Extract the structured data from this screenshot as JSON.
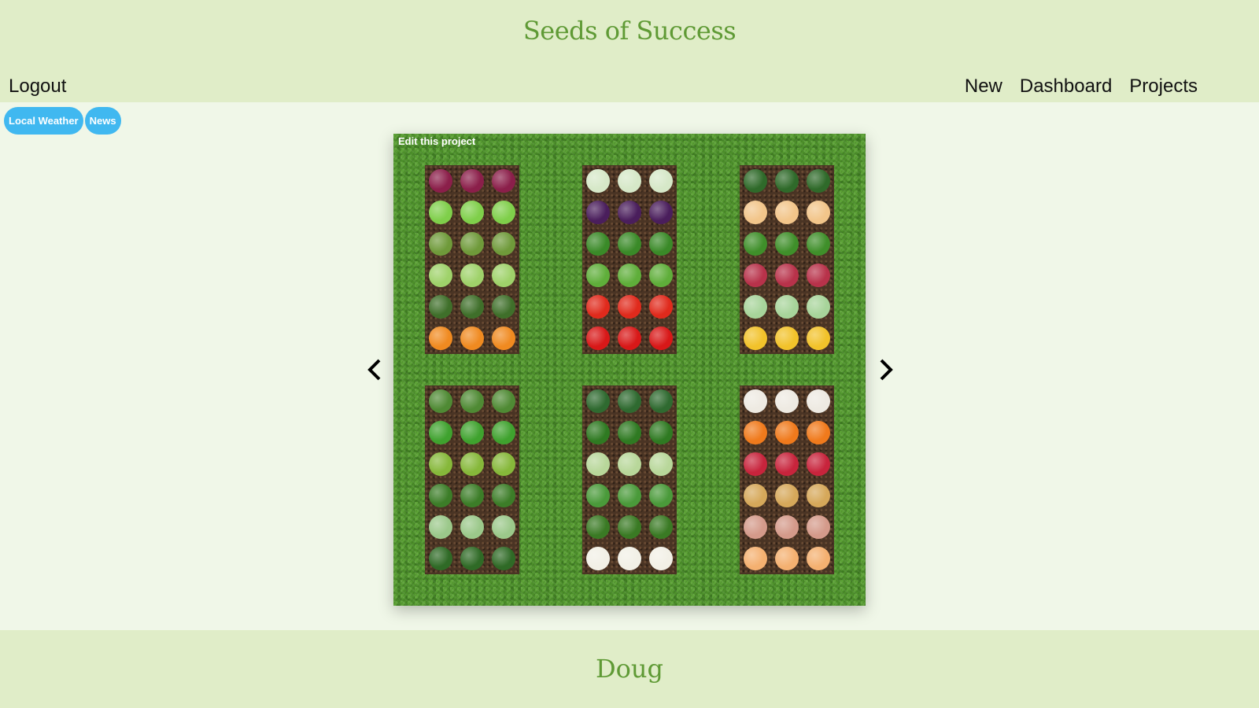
{
  "header": {
    "site_title": "Seeds of Success",
    "logout_label": "Logout",
    "nav": [
      "New",
      "Dashboard",
      "Projects"
    ]
  },
  "quick_links": [
    "Local Weather",
    "News"
  ],
  "garden": {
    "edit_label": "Edit this project",
    "beds": [
      [
        "beet",
        "bok-choy",
        "asparagus",
        "cabbage",
        "zucchini",
        "pumpkin"
      ],
      [
        "leek",
        "eggplant",
        "pea-pod",
        "green-bean",
        "tomato",
        "red-pepper"
      ],
      [
        "watermelon",
        "cantaloupe",
        "lettuce",
        "rhubarb",
        "chard",
        "corn"
      ],
      [
        "herb",
        "basil",
        "leaf-lettuce",
        "parsley",
        "dill",
        "rosemary"
      ],
      [
        "spinach",
        "cucumber",
        "savoy-cabbage",
        "kale",
        "broccoli",
        "cauliflower"
      ],
      [
        "garlic",
        "carrot",
        "radish",
        "potato",
        "sweet-potato",
        "onion"
      ]
    ],
    "colors": {
      "beet": "#8b1f4a",
      "bok-choy": "#7fcf4a",
      "asparagus": "#6f9a3a",
      "cabbage": "#9fd26a",
      "zucchini": "#3f6f2a",
      "pumpkin": "#f08a20",
      "leek": "#d6e8c8",
      "eggplant": "#4a1e5c",
      "pea-pod": "#3a8a28",
      "green-bean": "#5fae3a",
      "tomato": "#e02a1c",
      "red-pepper": "#d81818",
      "watermelon": "#2f6a2a",
      "cantaloupe": "#f2c58a",
      "lettuce": "#3f8f2a",
      "rhubarb": "#b8324a",
      "chard": "#a7d49a",
      "corn": "#f2c22a",
      "herb": "#4f8a34",
      "basil": "#3fa22e",
      "leaf-lettuce": "#86b83a",
      "parsley": "#3c7d28",
      "dill": "#9bc88a",
      "rosemary": "#2f6a26",
      "spinach": "#2f6a30",
      "cucumber": "#2f7a22",
      "savoy-cabbage": "#b8d79a",
      "kale": "#4a9a3a",
      "broccoli": "#3a7a24",
      "cauliflower": "#f2f0e6",
      "garlic": "#eeeae2",
      "carrot": "#f07a1c",
      "radish": "#c8243c",
      "potato": "#d6a85a",
      "sweet-potato": "#d49a8a",
      "onion": "#f4b070"
    }
  },
  "footer": {
    "user_name": "Doug"
  }
}
